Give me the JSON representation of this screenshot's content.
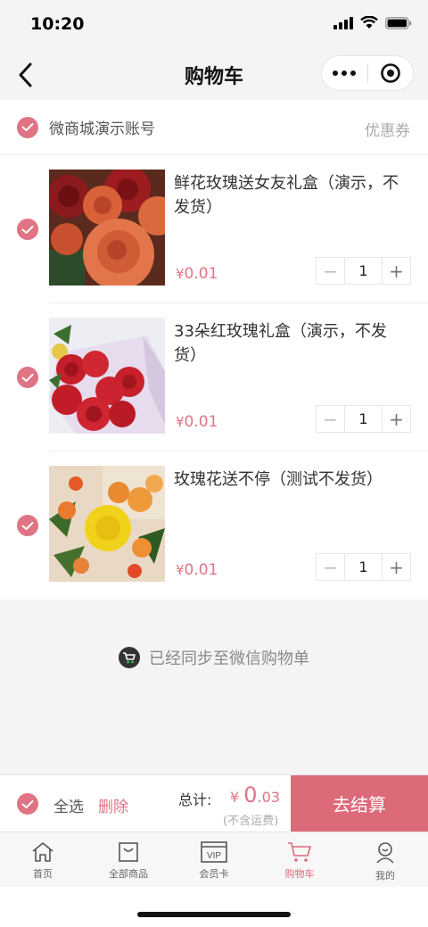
{
  "status": {
    "time": "10:20"
  },
  "nav": {
    "title": "购物车"
  },
  "shop": {
    "name": "微商城演示账号",
    "coupon": "优惠券"
  },
  "items": [
    {
      "name": "鲜花玫瑰送女友礼盒（演示，不发货）",
      "currency": "¥",
      "price": "0.01",
      "qty": "1"
    },
    {
      "name": "33朵红玫瑰礼盒（演示，不发货）",
      "currency": "¥",
      "price": "0.01",
      "qty": "1"
    },
    {
      "name": "玫瑰花送不停（测试不发货）",
      "currency": "¥",
      "price": "0.01",
      "qty": "1"
    }
  ],
  "sync": {
    "text": "已经同步至微信购物单"
  },
  "checkout": {
    "select_all": "全选",
    "delete": "删除",
    "total_label": "总计:",
    "currency": "¥",
    "total_int": "0",
    "total_dec": ".03",
    "shipping_note": "(不含运费)",
    "button": "去结算"
  },
  "tabs": [
    {
      "label": "首页",
      "icon": "home-icon"
    },
    {
      "label": "全部商品",
      "icon": "shopping-bag-icon"
    },
    {
      "label": "会员卡",
      "icon": "vip-card-icon"
    },
    {
      "label": "购物车",
      "icon": "cart-icon",
      "active": true
    },
    {
      "label": "我的",
      "icon": "user-icon"
    }
  ],
  "colors": {
    "accent": "#dc6a79",
    "check": "#e07384",
    "background": "#f4f4f4"
  }
}
